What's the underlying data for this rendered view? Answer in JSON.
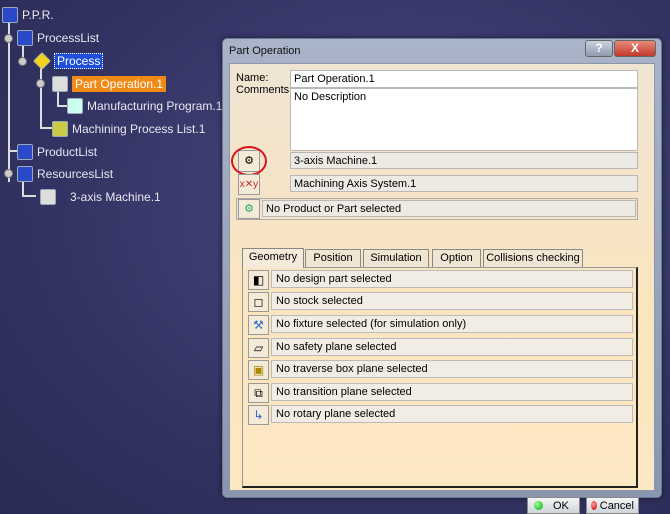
{
  "tree": {
    "items": [
      {
        "label": "P.P.R.",
        "icon": "ppr-icon"
      },
      {
        "label": "ProcessList",
        "icon": "process-list-icon"
      },
      {
        "label": "Process",
        "icon": "process-icon"
      },
      {
        "label": "Part Operation.1",
        "icon": "part-operation-icon"
      },
      {
        "label": "Manufacturing Program.1",
        "icon": "manufacturing-program-icon"
      },
      {
        "label": "Machining Process List.1",
        "icon": "machining-process-list-icon"
      },
      {
        "label": "ProductList",
        "icon": "product-list-icon"
      },
      {
        "label": "ResourcesList",
        "icon": "resources-list-icon"
      },
      {
        "label": "3-axis Machine.1",
        "icon": "machine-icon"
      }
    ]
  },
  "dialog": {
    "title": "Part Operation",
    "help": "?",
    "close": "X",
    "name_label": "Name:",
    "name_value": "Part Operation.1",
    "comments_label": "Comments:",
    "comments_value": "No Description",
    "machine_value": "3-axis Machine.1",
    "axis_value": "Machining Axis System.1",
    "product_value": "No Product or Part selected",
    "tabs": [
      "Geometry",
      "Position",
      "Simulation",
      "Option",
      "Collisions checking"
    ],
    "active_tab": "Geometry",
    "rows": [
      "No design part selected",
      "No stock selected",
      "No fixture selected (for simulation only)",
      "No safety plane selected",
      "No traverse box plane selected",
      "No transition plane selected",
      "No rotary plane selected"
    ],
    "ok": "OK",
    "cancel": "Cancel"
  },
  "colors": {
    "selection": "#1f4fd8",
    "highlight": "#f08a16",
    "annotation_circle": "#d8141e"
  }
}
